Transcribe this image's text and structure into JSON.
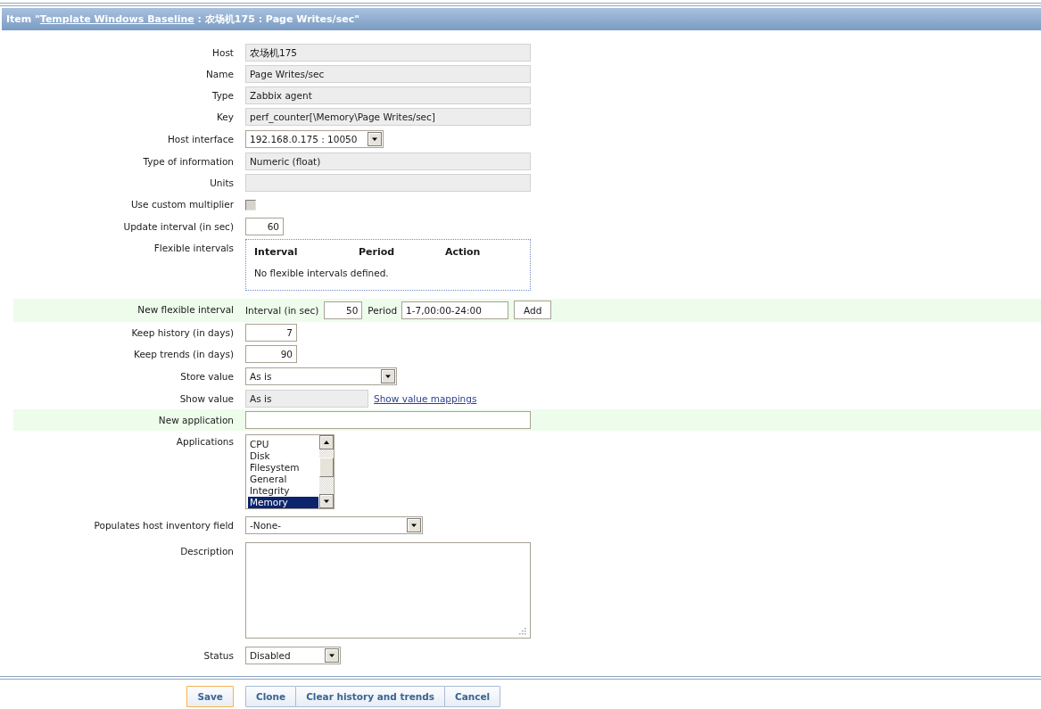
{
  "header": {
    "prefix": "Item \"",
    "link": "Template Windows Baseline",
    "suffix": " : 农场机175 : Page Writes/sec\""
  },
  "fields": [
    {
      "kind": "readonly",
      "label": "Host",
      "value": "农场机175",
      "highlighted": false
    },
    {
      "kind": "readonly",
      "label": "Name",
      "value": "Page Writes/sec",
      "highlighted": false
    },
    {
      "kind": "readonly",
      "label": "Type",
      "value": "Zabbix agent",
      "highlighted": false
    },
    {
      "kind": "readonly",
      "label": "Key",
      "value": "perf_counter[\\Memory\\Page Writes/sec]",
      "highlighted": false
    },
    {
      "kind": "select",
      "label": "Host interface",
      "value": "192.168.0.175 : 10050",
      "highlighted": false
    },
    {
      "kind": "readonly",
      "label": "Type of information",
      "value": "Numeric (float)",
      "highlighted": false
    },
    {
      "kind": "readonly",
      "label": "Units",
      "highlighted": false
    },
    {
      "kind": "checkbox",
      "label": "Use custom multiplier",
      "checked": false,
      "disabled": true,
      "highlighted": false
    },
    {
      "kind": "number",
      "label": "Update interval (in sec)",
      "value": "60",
      "highlighted": false
    },
    {
      "kind": "flex_table",
      "label": "Flexible intervals",
      "columns": [
        "Interval",
        "Period",
        "Action"
      ],
      "empty_text": "No flexible intervals defined.",
      "highlighted": false
    },
    {
      "kind": "flex_new",
      "label": "New flexible interval",
      "interval_label": "Interval (in sec)",
      "interval_value": "50",
      "period_label": "Period",
      "period_value": "1-7,00:00-24:00",
      "button": "Add",
      "highlighted": true
    },
    {
      "kind": "number",
      "label": "Keep history (in days)",
      "value": "7",
      "highlighted": false
    },
    {
      "kind": "number",
      "label": "Keep trends (in days)",
      "value": "90",
      "highlighted": false
    },
    {
      "kind": "select",
      "label": "Store value",
      "value": "As is",
      "highlighted": false
    },
    {
      "kind": "readonly_link",
      "label": "Show value",
      "value": "As is",
      "link": "Show value mappings",
      "highlighted": false
    },
    {
      "kind": "text",
      "label": "New application",
      "highlighted": true
    },
    {
      "kind": "listbox",
      "label": "Applications",
      "items": [
        {
          "label": "CPU",
          "selected": false
        },
        {
          "label": "Disk",
          "selected": false
        },
        {
          "label": "Filesystem",
          "selected": false
        },
        {
          "label": "General",
          "selected": false
        },
        {
          "label": "Integrity",
          "selected": false
        },
        {
          "label": "Memory",
          "selected": true
        }
      ],
      "highlighted": false
    },
    {
      "kind": "select",
      "label": "Populates host inventory field",
      "value": "-None-",
      "highlighted": false
    },
    {
      "kind": "textarea",
      "label": "Description",
      "highlighted": false
    },
    {
      "kind": "select",
      "label": "Status",
      "value": "Disabled",
      "highlighted": false
    }
  ],
  "buttons": [
    {
      "label": "Save",
      "focused": true
    },
    {
      "label": "Clone",
      "focused": false
    },
    {
      "label": "Clear history and trends",
      "focused": false
    },
    {
      "label": "Cancel",
      "focused": false
    }
  ]
}
